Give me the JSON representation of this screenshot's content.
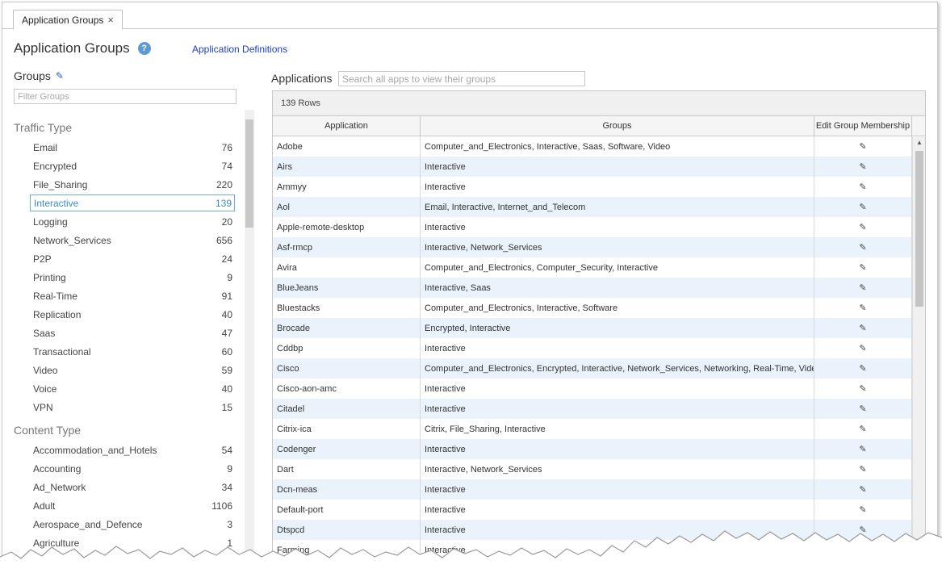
{
  "tab": {
    "label": "Application Groups",
    "close": "×"
  },
  "header": {
    "title": "Application Groups",
    "help": "?",
    "link": "Application Definitions"
  },
  "groups": {
    "title": "Groups",
    "filter_placeholder": "Filter Groups",
    "sections": [
      {
        "title": "Traffic Type",
        "items": [
          {
            "label": "Email",
            "count": "76"
          },
          {
            "label": "Encrypted",
            "count": "74"
          },
          {
            "label": "File_Sharing",
            "count": "220"
          },
          {
            "label": "Interactive",
            "count": "139"
          },
          {
            "label": "Logging",
            "count": "20"
          },
          {
            "label": "Network_Services",
            "count": "656"
          },
          {
            "label": "P2P",
            "count": "24"
          },
          {
            "label": "Printing",
            "count": "9"
          },
          {
            "label": "Real-Time",
            "count": "91"
          },
          {
            "label": "Replication",
            "count": "40"
          },
          {
            "label": "Saas",
            "count": "47"
          },
          {
            "label": "Transactional",
            "count": "60"
          },
          {
            "label": "Video",
            "count": "59"
          },
          {
            "label": "Voice",
            "count": "40"
          },
          {
            "label": "VPN",
            "count": "15"
          }
        ]
      },
      {
        "title": "Content Type",
        "items": [
          {
            "label": "Accommodation_and_Hotels",
            "count": "54"
          },
          {
            "label": "Accounting",
            "count": "9"
          },
          {
            "label": "Ad_Network",
            "count": "34"
          },
          {
            "label": "Adult",
            "count": "1106"
          },
          {
            "label": "Aerospace_and_Defence",
            "count": "3"
          },
          {
            "label": "Agriculture",
            "count": "1"
          }
        ]
      }
    ],
    "selected": "Interactive"
  },
  "applications": {
    "title": "Applications",
    "search_placeholder": "Search all apps to view their groups",
    "row_count": "139 Rows",
    "columns": [
      "Application",
      "Groups",
      "Edit Group Membership"
    ],
    "rows": [
      [
        "Adobe",
        "Computer_and_Electronics, Interactive, Saas, Software, Video"
      ],
      [
        "Airs",
        "Interactive"
      ],
      [
        "Ammyy",
        "Interactive"
      ],
      [
        "Aol",
        "Email, Interactive, Internet_and_Telecom"
      ],
      [
        "Apple-remote-desktop",
        "Interactive"
      ],
      [
        "Asf-rmcp",
        "Interactive, Network_Services"
      ],
      [
        "Avira",
        "Computer_and_Electronics, Computer_Security, Interactive"
      ],
      [
        "BlueJeans",
        "Interactive, Saas"
      ],
      [
        "Bluestacks",
        "Computer_and_Electronics, Interactive, Software"
      ],
      [
        "Brocade",
        "Encrypted, Interactive"
      ],
      [
        "Cddbp",
        "Interactive"
      ],
      [
        "Cisco",
        "Computer_and_Electronics, Encrypted, Interactive, Network_Services, Networking, Real-Time, Vide..."
      ],
      [
        "Cisco-aon-amc",
        "Interactive"
      ],
      [
        "Citadel",
        "Interactive"
      ],
      [
        "Citrix-ica",
        "Citrix, File_Sharing, Interactive"
      ],
      [
        "Codenger",
        "Interactive"
      ],
      [
        "Dart",
        "Interactive, Network_Services"
      ],
      [
        "Dcn-meas",
        "Interactive"
      ],
      [
        "Default-port",
        "Interactive"
      ],
      [
        "Dtspcd",
        "Interactive"
      ],
      [
        "Farming",
        "Interactive"
      ]
    ]
  },
  "colors": {
    "accent": "#3a8ec8",
    "link": "#1a3ec8",
    "row_alt": "#eaf3fb",
    "help": "#5b9bd5"
  },
  "icons": {
    "edit": "pencil-icon",
    "help": "help-icon",
    "close": "close-icon"
  }
}
